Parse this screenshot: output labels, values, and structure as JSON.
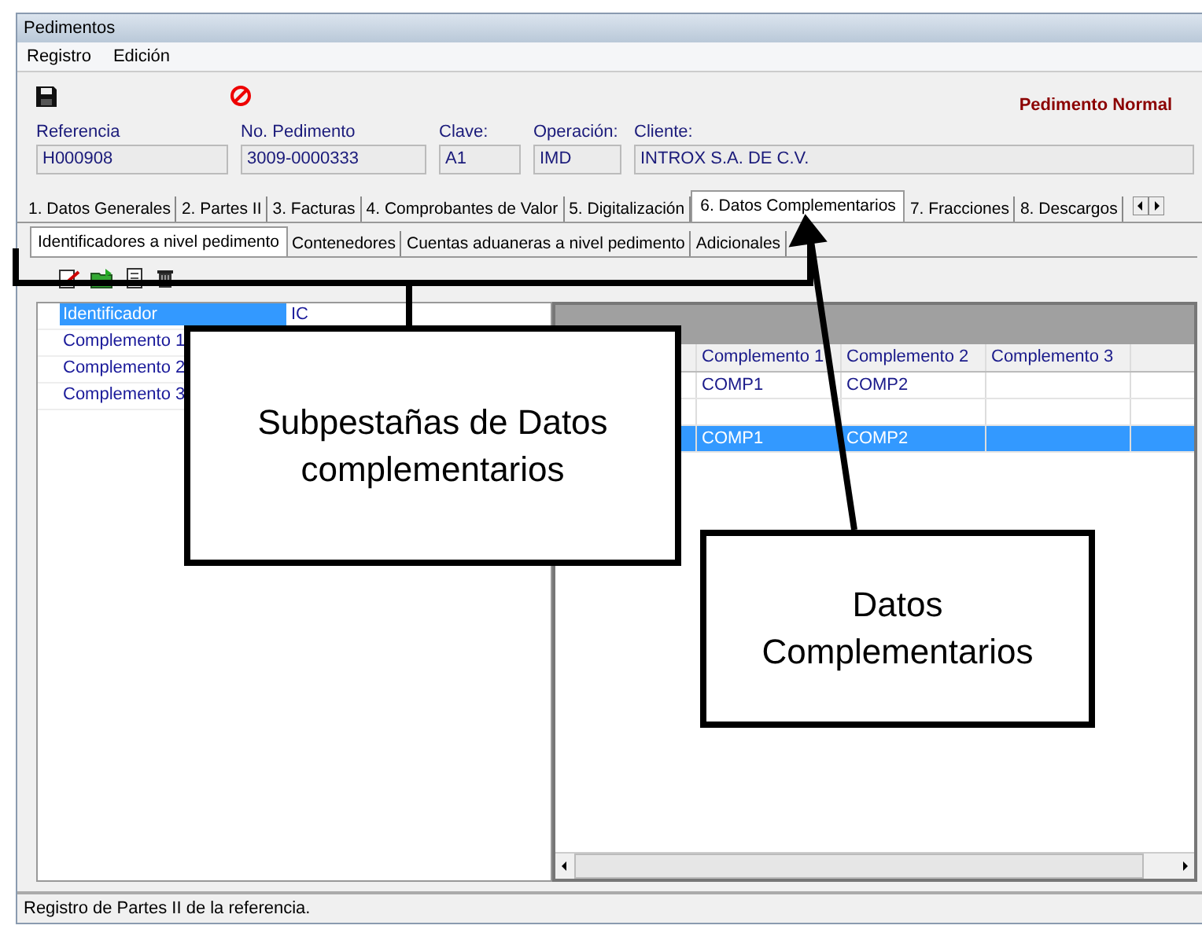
{
  "window": {
    "title": "Pedimentos"
  },
  "menu": [
    "Registro",
    "Edición"
  ],
  "badge": "Pedimento Normal",
  "fields": [
    {
      "label": "Referencia",
      "value": "H000908"
    },
    {
      "label": "No. Pedimento",
      "value": "3009-0000333"
    },
    {
      "label": "Clave:",
      "value": "A1"
    },
    {
      "label": "Operación:",
      "value": "IMD"
    },
    {
      "label": "Cliente:",
      "value": "INTROX S.A. DE C.V."
    }
  ],
  "tabs": [
    {
      "label": "1. Datos Generales",
      "selected": false
    },
    {
      "label": "2. Partes II",
      "selected": false
    },
    {
      "label": "3. Facturas",
      "selected": false
    },
    {
      "label": "4. Comprobantes de Valor",
      "selected": false
    },
    {
      "label": "5. Digitalización",
      "selected": false
    },
    {
      "label": "6. Datos Complementarios",
      "selected": true
    },
    {
      "label": "7. Fracciones",
      "selected": false
    },
    {
      "label": "8. Descargos",
      "selected": false
    }
  ],
  "subtabs": [
    {
      "label": "Identificadores a nivel pedimento",
      "selected": true
    },
    {
      "label": "Contenedores",
      "selected": false
    },
    {
      "label": "Cuentas aduaneras a nivel pedimento",
      "selected": false
    },
    {
      "label": "Adicionales",
      "selected": false
    }
  ],
  "identifiers": [
    {
      "name": "Identificador",
      "value": "IC",
      "selected": true
    },
    {
      "name": "Complemento 1",
      "selected": false
    },
    {
      "name": "Complemento 2",
      "selected": false
    },
    {
      "name": "Complemento 3",
      "selected": false
    }
  ],
  "grid": {
    "columns": [
      "Complemento 1",
      "Complemento 2",
      "Complemento 3"
    ],
    "rows": [
      {
        "complemento_1": "COMP1",
        "complemento_2": "COMP2",
        "selected": false
      },
      {
        "selected": false
      },
      {
        "complemento_1": "COMP1",
        "complemento_2": "COMP2",
        "selected": true
      }
    ]
  },
  "status_bar": "Registro de Partes II de la referencia.",
  "callouts": [
    {
      "text": "Subpestañas de Datos complementarios"
    },
    {
      "text": "Datos Complementarios"
    }
  ]
}
